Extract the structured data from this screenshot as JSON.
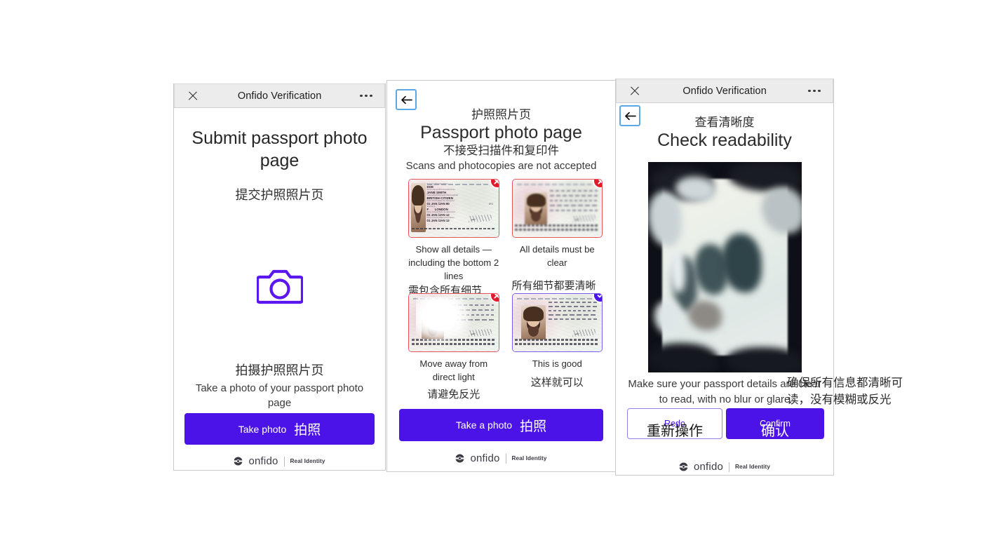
{
  "app": {
    "window_title": "Onfido Verification",
    "brand_name": "onfido",
    "brand_tagline": "Real Identity",
    "accent_color": "#4b13e8",
    "error_color": "#e21b2c",
    "focus_ring_color": "#5aa9e6"
  },
  "panel1": {
    "titlebar": {
      "title": "Onfido Verification",
      "close_icon": "close-icon",
      "more_icon": "more-options-icon"
    },
    "heading_en": "Submit passport photo page",
    "heading_cn": "提交护照照片页",
    "camera_icon": "camera-icon",
    "prompt_cn": "拍摄护照照片页",
    "prompt_en": "Take a photo of your passport photo page",
    "cta": {
      "en": "Take photo",
      "cn": "拍照"
    },
    "footer": {
      "brand": "onfido",
      "tagline": "Real Identity"
    }
  },
  "panel2": {
    "back_icon": "back-arrow-icon",
    "heading_cn": "护照照片页",
    "heading_en": "Passport photo page",
    "sub_cn": "不接受扫描件和复印件",
    "sub_en": "Scans and photocopies are not accepted",
    "examples": [
      {
        "id": "show-all-details",
        "status": "bad",
        "badge_icon": "error-cross-icon",
        "caption_en": "Show all details — including the bottom 2 lines",
        "caption_cn": "需包含所有细节——包括最后两行"
      },
      {
        "id": "all-details-clear",
        "status": "bad",
        "badge_icon": "error-cross-icon",
        "caption_en": "All details must be clear",
        "caption_cn": "所有细节都要清晰可见"
      },
      {
        "id": "avoid-direct-light",
        "status": "bad",
        "badge_icon": "error-cross-icon",
        "caption_en": "Move away from direct light",
        "caption_cn": "请避免反光"
      },
      {
        "id": "this-is-good",
        "status": "good",
        "badge_icon": "success-check-icon",
        "caption_en": "This is good",
        "caption_cn": "这样就可以"
      }
    ],
    "passport_sample": {
      "surname_label": "Surname/Nom/Apellidos",
      "surname": "DOE",
      "given_names_label": "Given names/Prénoms/Nombres",
      "given_names": "JANE SMITH",
      "nationality_label": "Nationality/Nationalité/Nacionalidad",
      "nationality": "BRITISH CITIZEN",
      "dob_label": "Date of birth/Date de naissance",
      "dob": "01 JAN /JAN 90",
      "sex_label": "Sex/Sexe",
      "sex": "F",
      "birthplace_label": "Place of birth/Lieu de naissance",
      "birthplace": "LONDON",
      "issue_label": "Date of issue/Date de délivrance",
      "issue": "01  JAN /JAN 12",
      "authority_label": "Authority/Autorité",
      "authority": "IPS",
      "expiry_label": "Date of expiry/Date d'expiration",
      "expiry": "01  JAN /JAN 12",
      "signature_label": "Holder's signature/Signature du titulaire",
      "mrz_line": "JANE<<SMITH<<<<<<<<<<<<<<<<<<<<"
    },
    "cta": {
      "en": "Take a photo",
      "cn": "拍照"
    },
    "footer": {
      "brand": "onfido",
      "tagline": "Real Identity"
    }
  },
  "panel3": {
    "titlebar": {
      "title": "Onfido Verification",
      "close_icon": "close-icon",
      "more_icon": "more-options-icon"
    },
    "back_icon": "back-arrow-icon",
    "heading_cn": "查看清晰度",
    "heading_en": "Check readability",
    "preview_alt": "captured-passport-photo",
    "hint_en": "Make sure your passport details are clear to read, with no blur or glare",
    "hint_cn": "确保所有信息都清晰可读，没有模糊或反光",
    "redo": {
      "en": "Redo",
      "cn": "重新操作"
    },
    "confirm": {
      "en": "Confirm",
      "cn": "确认"
    },
    "footer": {
      "brand": "onfido",
      "tagline": "Real Identity"
    }
  }
}
